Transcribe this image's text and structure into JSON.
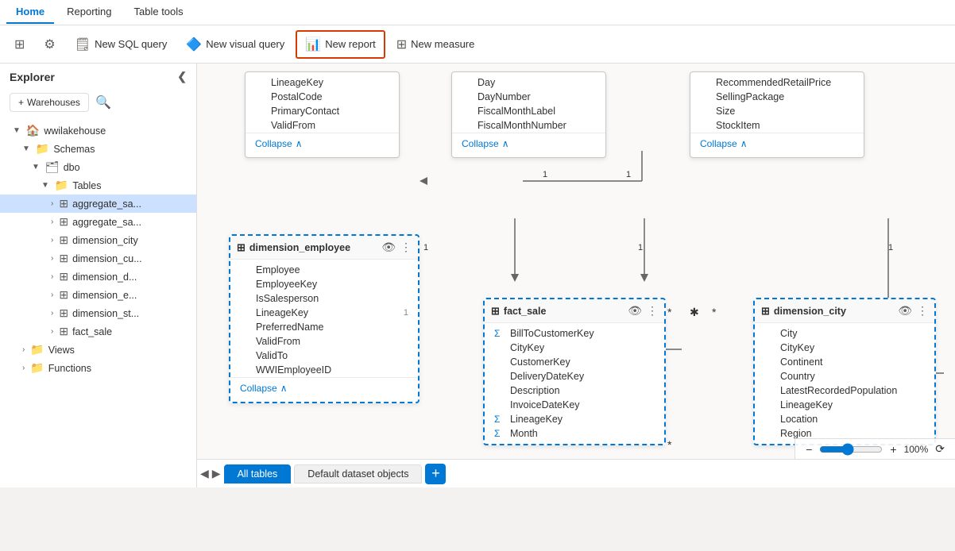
{
  "tabs": [
    {
      "label": "Home",
      "active": true
    },
    {
      "label": "Reporting",
      "active": false
    },
    {
      "label": "Table tools",
      "active": false
    }
  ],
  "toolbar": {
    "buttons": [
      {
        "id": "icon1",
        "icon": "⊞",
        "label": "",
        "hasLabel": false
      },
      {
        "id": "icon2",
        "icon": "⚙",
        "label": "",
        "hasLabel": false
      },
      {
        "id": "new-sql",
        "icon": "◧",
        "label": "New SQL query",
        "hasLabel": true
      },
      {
        "id": "new-visual",
        "icon": "◨",
        "label": "New visual query",
        "hasLabel": true
      },
      {
        "id": "new-report",
        "icon": "▦",
        "label": "New report",
        "hasLabel": true,
        "highlighted": true
      },
      {
        "id": "new-measure",
        "icon": "▤",
        "label": "New measure",
        "hasLabel": true
      }
    ]
  },
  "sidebar": {
    "title": "Explorer",
    "warehouses_label": "Warehouses",
    "tree": [
      {
        "label": "wwilakehouse",
        "icon": "🏠",
        "indent": 0,
        "type": "root",
        "expanded": true
      },
      {
        "label": "Schemas",
        "icon": "📁",
        "indent": 1,
        "type": "folder",
        "expanded": true
      },
      {
        "label": "dbo",
        "icon": "🗂",
        "indent": 2,
        "type": "schema",
        "expanded": true
      },
      {
        "label": "Tables",
        "icon": "📁",
        "indent": 3,
        "type": "folder",
        "expanded": true
      },
      {
        "label": "aggregate_sa...",
        "icon": "⊞",
        "indent": 4,
        "type": "table",
        "selected": true
      },
      {
        "label": "aggregate_sa...",
        "icon": "⊞",
        "indent": 4,
        "type": "table"
      },
      {
        "label": "dimension_city",
        "icon": "⊞",
        "indent": 4,
        "type": "table"
      },
      {
        "label": "dimension_cu...",
        "icon": "⊞",
        "indent": 4,
        "type": "table"
      },
      {
        "label": "dimension_d...",
        "icon": "⊞",
        "indent": 4,
        "type": "table"
      },
      {
        "label": "dimension_e...",
        "icon": "⊞",
        "indent": 4,
        "type": "table"
      },
      {
        "label": "dimension_st...",
        "icon": "⊞",
        "indent": 4,
        "type": "table"
      },
      {
        "label": "fact_sale",
        "icon": "⊞",
        "indent": 4,
        "type": "table"
      },
      {
        "label": "Views",
        "icon": "📁",
        "indent": 1,
        "type": "folder"
      },
      {
        "label": "Functions",
        "icon": "📁",
        "indent": 1,
        "type": "folder"
      }
    ]
  },
  "bottom_tabs": [
    {
      "label": "All tables",
      "active": true
    },
    {
      "label": "Default dataset objects",
      "active": false
    }
  ],
  "zoom": {
    "level": "100%",
    "minus": "-",
    "plus": "+"
  },
  "tables": {
    "top_left": {
      "title": "",
      "fields": [
        "LineageKey",
        "PostalCode",
        "PrimaryContact",
        "ValidFrom"
      ],
      "collapse": "Collapse"
    },
    "top_middle": {
      "title": "",
      "fields": [
        "Day",
        "DayNumber",
        "FiscalMonthLabel",
        "FiscalMonthNumber"
      ],
      "collapse": "Collapse"
    },
    "top_right": {
      "title": "",
      "fields": [
        "RecommendedRetailPrice",
        "SellingPackage",
        "Size",
        "StockItem"
      ],
      "collapse": "Collapse"
    },
    "dimension_employee": {
      "title": "dimension_employee",
      "fields": [
        "Employee",
        "EmployeeKey",
        "IsSalesperson",
        "LineageKey",
        "PreferredName",
        "ValidFrom",
        "ValidTo",
        "WWIEmployeeID"
      ],
      "collapse": "Collapse"
    },
    "fact_sale": {
      "title": "fact_sale",
      "fields": [
        "BillToCustomerKey",
        "CityKey",
        "CustomerKey",
        "DeliveryDateKey",
        "Description",
        "InvoiceDateKey",
        "LineageKey",
        "Month"
      ],
      "sigma_fields": [
        "BillToCustomerKey",
        "LineageKey",
        "Month"
      ]
    },
    "dimension_city": {
      "title": "dimension_city",
      "fields": [
        "City",
        "CityKey",
        "Continent",
        "Country",
        "LatestRecordedPopulation",
        "LineageKey",
        "Location",
        "Region"
      ],
      "collapse": ""
    }
  },
  "colors": {
    "accent": "#0078d4",
    "highlight_border": "#d83b01",
    "selected_card": "#0078d4",
    "toolbar_bg": "#ffffff",
    "canvas_bg": "#faf9f8"
  }
}
